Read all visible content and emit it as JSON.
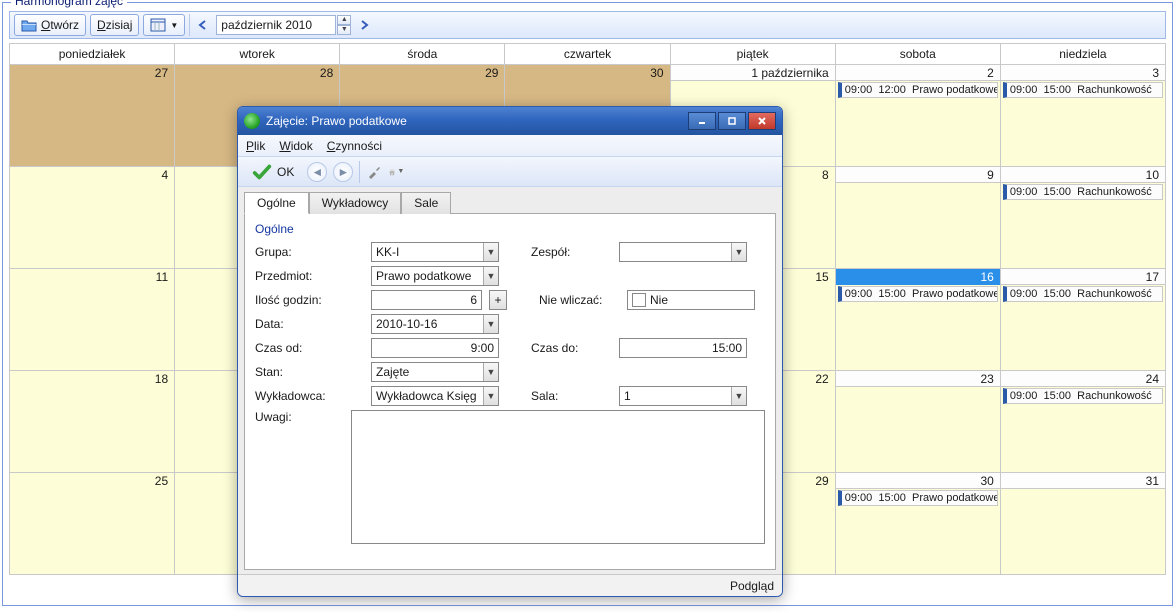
{
  "panel": {
    "title": "Harmonogram zajęć"
  },
  "toolbar": {
    "open": "Otwórz",
    "today": "Dzisiaj",
    "month": "październik 2010"
  },
  "calendar": {
    "weekdays": [
      "poniedziałek",
      "wtorek",
      "środa",
      "czwartek",
      "piątek",
      "sobota",
      "niedziela"
    ],
    "first_label": "1 października",
    "rows": [
      {
        "days": [
          "27",
          "28",
          "29",
          "30",
          "1",
          "2",
          "3"
        ],
        "other": [
          true,
          true,
          true,
          true,
          false,
          false,
          false
        ]
      },
      {
        "days": [
          "4",
          "",
          "",
          "",
          "8",
          "9",
          "10"
        ]
      },
      {
        "days": [
          "11",
          "",
          "",
          "",
          "15",
          "16",
          "17"
        ]
      },
      {
        "days": [
          "18",
          "",
          "",
          "",
          "22",
          "23",
          "24"
        ]
      },
      {
        "days": [
          "25",
          "",
          "",
          "",
          "29",
          "30",
          "31"
        ]
      }
    ],
    "events": {
      "r0c5": {
        "start": "09:00",
        "end": "12:00",
        "title": "Prawo podatkowe"
      },
      "r0c6": {
        "start": "09:00",
        "end": "15:00",
        "title": "Rachunkowość"
      },
      "r1c6": {
        "start": "09:00",
        "end": "15:00",
        "title": "Rachunkowość"
      },
      "r2c5": {
        "start": "09:00",
        "end": "15:00",
        "title": "Prawo podatkowe"
      },
      "r2c6": {
        "start": "09:00",
        "end": "15:00",
        "title": "Rachunkowość"
      },
      "r3c6": {
        "start": "09:00",
        "end": "15:00",
        "title": "Rachunkowość"
      },
      "r4c5": {
        "start": "09:00",
        "end": "15:00",
        "title": "Prawo podatkowe"
      }
    }
  },
  "dialog": {
    "title": "Zajęcie: Prawo podatkowe",
    "menu": {
      "file": "Plik",
      "view": "Widok",
      "actions": "Czynności"
    },
    "ok": "OK",
    "tabs": {
      "general": "Ogólne",
      "lecturers": "Wykładowcy",
      "rooms": "Sale"
    },
    "group_heading": "Ogólne",
    "labels": {
      "grupa": "Grupa:",
      "przedmiot": "Przedmiot:",
      "ilosc": "Ilość godzin:",
      "data": "Data:",
      "czas_od": "Czas od:",
      "stan": "Stan:",
      "wykladowca": "Wykładowca:",
      "uwagi": "Uwagi:",
      "zespol": "Zespół:",
      "nie_wliczac": "Nie wliczać:",
      "czas_do": "Czas do:",
      "sala": "Sala:"
    },
    "values": {
      "grupa": "KK-I",
      "przedmiot": "Prawo podatkowe",
      "ilosc": "6",
      "data": "2010-10-16",
      "czas_od": "9:00",
      "stan": "Zajęte",
      "wykladowca": "Wykładowca Księgowość",
      "zespol": "",
      "nie_wliczac": "Nie",
      "czas_do": "15:00",
      "sala": "1",
      "uwagi": ""
    },
    "status": "Podgląd"
  }
}
